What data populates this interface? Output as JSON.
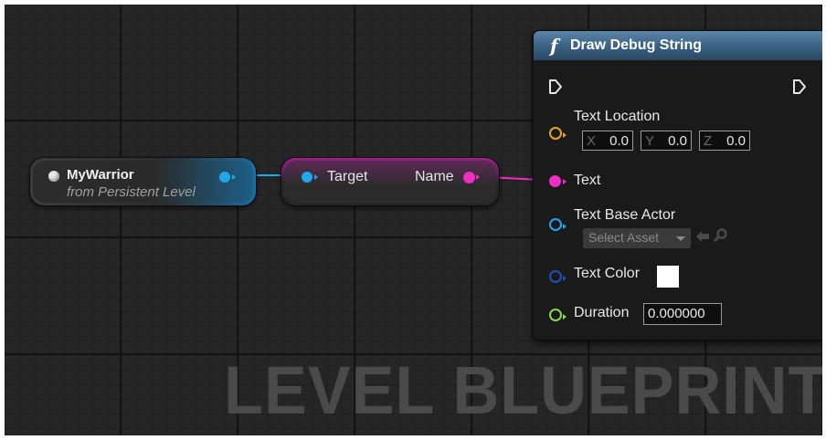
{
  "watermark": "LEVEL BLUEPRINT",
  "ref_node": {
    "title": "MyWarrior",
    "subtitle": "from Persistent Level"
  },
  "getter_node": {
    "target_label": "Target",
    "name_label": "Name"
  },
  "debug_node": {
    "icon": "f",
    "title": "Draw Debug String",
    "text_location": {
      "label": "Text Location",
      "x_axis": "X",
      "x": "0.0",
      "y_axis": "Y",
      "y": "0.0",
      "z_axis": "Z",
      "z": "0.0"
    },
    "text_label": "Text",
    "text_base_actor": {
      "label": "Text Base Actor",
      "select_asset": "Select Asset"
    },
    "text_color": {
      "label": "Text Color",
      "value": "#ffffff"
    },
    "duration": {
      "label": "Duration",
      "value": "0.000000"
    }
  },
  "colors": {
    "object_pin": "#1ea8ea",
    "string_pin": "#ee2fc4",
    "vector_pin": "#e3a52c",
    "color_pin": "#1c4fbf",
    "float_pin": "#8ad84e",
    "header": "#3f678c"
  },
  "icons": [
    "ref-dot-icon",
    "exec-in-icon",
    "exec-out-icon",
    "use-selected-icon",
    "browse-icon",
    "dropdown-caret-icon"
  ]
}
